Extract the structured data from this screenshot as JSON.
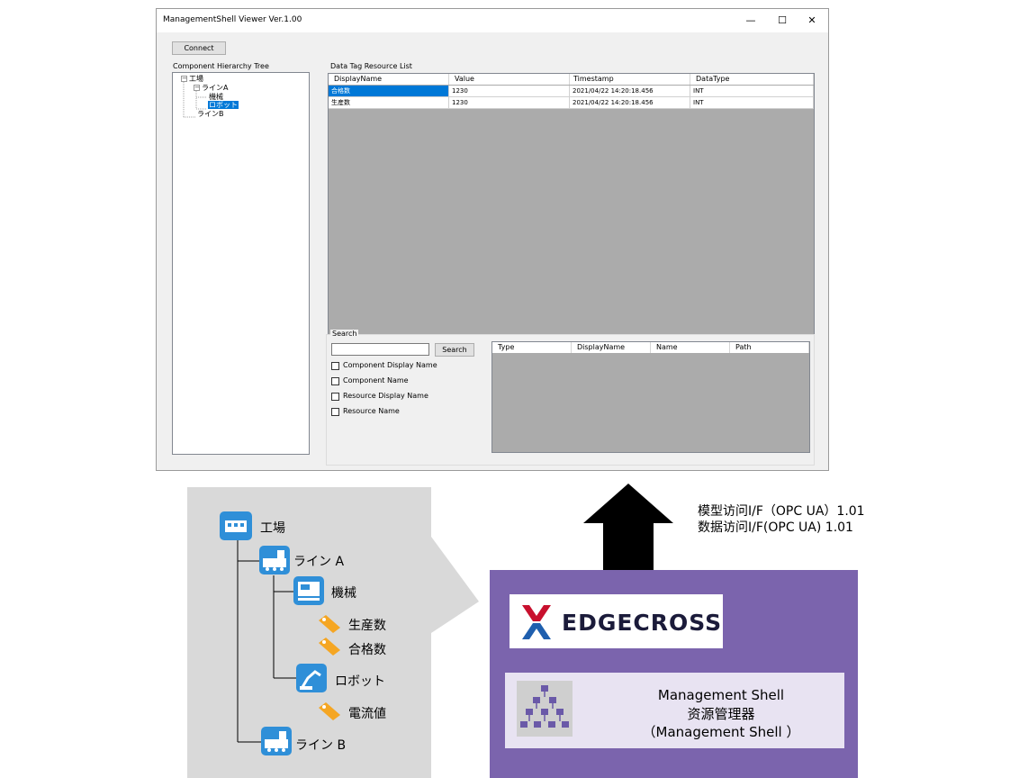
{
  "window": {
    "title": "ManagementShell Viewer Ver.1.00",
    "minimize_glyph": "—",
    "maximize_glyph": "☐",
    "close_glyph": "✕",
    "connect_label": "Connect",
    "tree_label": "Component Hierarchy Tree",
    "data_label": "Data Tag Resource List",
    "tree": {
      "root": "工場",
      "line_a": "ラインA",
      "machine": "機械",
      "robot": "ロボット",
      "line_b": "ラインB",
      "expand_glyph": "−"
    },
    "data_grid": {
      "columns": [
        "DisplayName",
        "Value",
        "Timestamp",
        "DataType"
      ],
      "rows": [
        [
          "合格数",
          "1230",
          "2021/04/22 14:20:18.456",
          "INT"
        ],
        [
          "生産数",
          "1230",
          "2021/04/22 14:20:18.456",
          "INT"
        ]
      ]
    },
    "search": {
      "legend": "Search",
      "input_value": "",
      "button_label": "Search",
      "checkboxes": [
        "Component Display Name",
        "Component Name",
        "Resource Display Name",
        "Resource Name"
      ],
      "result_columns": [
        "Type",
        "DisplayName",
        "Name",
        "Path"
      ]
    }
  },
  "diagram": {
    "tree": {
      "factory": "工場",
      "line_a": "ライン A",
      "machine": "機械",
      "production": "生産数",
      "pass_count": "合格数",
      "robot": "ロボット",
      "current": "電流値",
      "line_b": "ライン B"
    },
    "interface_lines": [
      "模型访问I/F（OPC UA）1.01",
      "数据访问I/F(OPC UA) 1.01"
    ],
    "logo_text": "EDGECROSS",
    "ms_lines": [
      "Management Shell",
      "资源管理器",
      "（Management Shell ）"
    ],
    "colors": {
      "purple_panel": "#7b64ad",
      "icon_blue": "#2f8fd8",
      "tag_orange": "#f5a623",
      "logo_red": "#c8102e",
      "logo_blue": "#1f5fae"
    }
  }
}
